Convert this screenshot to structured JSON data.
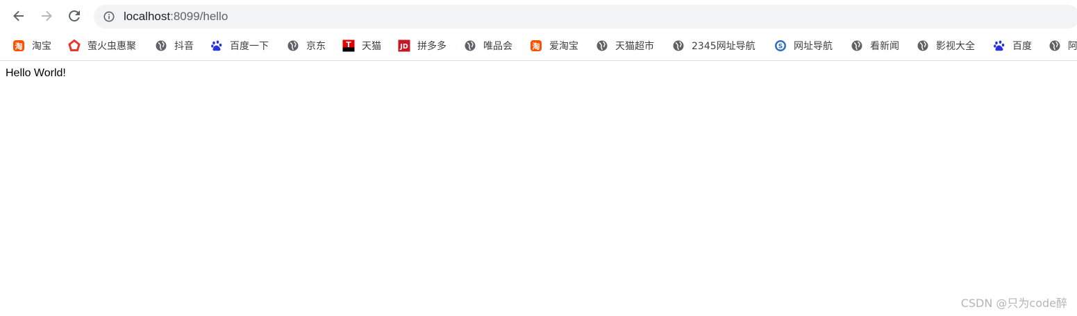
{
  "omnibox": {
    "host": "localhost",
    "path": ":8099/hello"
  },
  "bookmarks": [
    {
      "label": "淘宝",
      "icon": "taobao-icon"
    },
    {
      "label": "萤火虫惠聚",
      "icon": "firefly-icon"
    },
    {
      "label": "抖音",
      "icon": "globe-icon"
    },
    {
      "label": "百度一下",
      "icon": "baidu-icon"
    },
    {
      "label": "京东",
      "icon": "globe-icon"
    },
    {
      "label": "天猫",
      "icon": "tmall-icon"
    },
    {
      "label": "拼多多",
      "icon": "jd-icon"
    },
    {
      "label": "唯品会",
      "icon": "globe-icon"
    },
    {
      "label": "爱淘宝",
      "icon": "taobao-icon"
    },
    {
      "label": "天猫超市",
      "icon": "globe-icon"
    },
    {
      "label": "2345网址导航",
      "icon": "globe-icon"
    },
    {
      "label": "网址导航",
      "icon": "sogou-icon"
    },
    {
      "label": "看新闻",
      "icon": "globe-icon"
    },
    {
      "label": "影视大全",
      "icon": "globe-icon"
    },
    {
      "label": "百度",
      "icon": "baidu-icon"
    },
    {
      "label": "阿",
      "icon": "globe-icon"
    }
  ],
  "page": {
    "body_text": "Hello World!"
  },
  "watermark": "CSDN @只为code醉",
  "colors": {
    "taobao": "#ff5000",
    "tmall": "#e00000",
    "jd": "#c91623",
    "baidu": "#2932e1",
    "globe": "#5f6368",
    "sogou": "#2d6cc0"
  }
}
